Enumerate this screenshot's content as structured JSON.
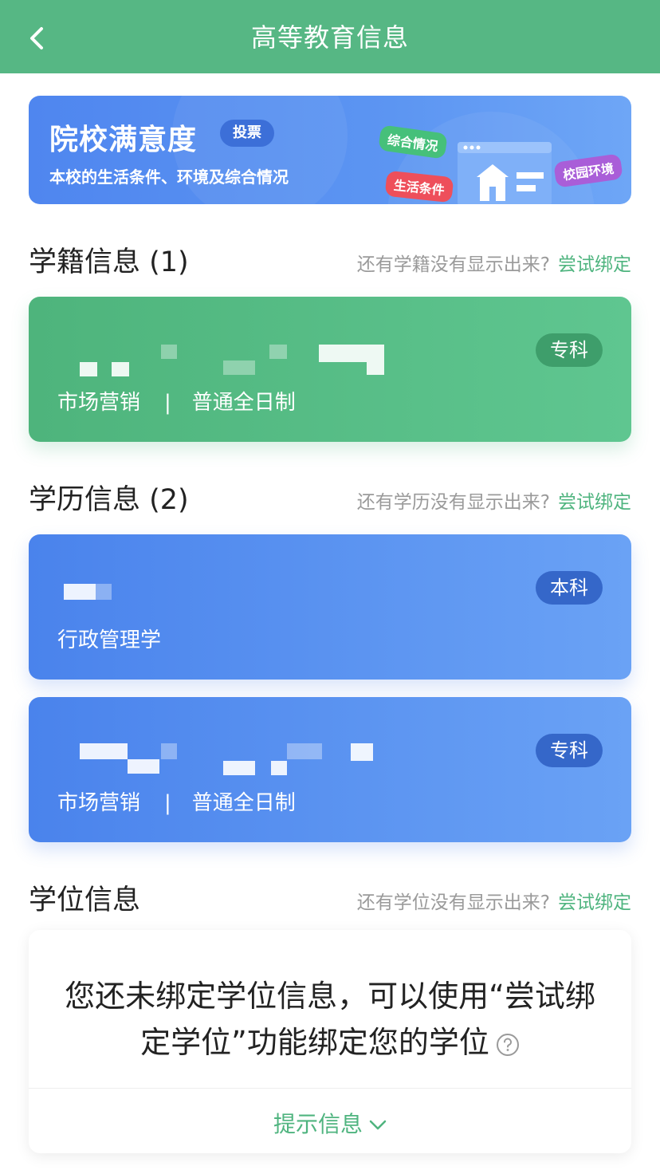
{
  "header": {
    "title": "高等教育信息",
    "back_icon": "chevron-left-icon"
  },
  "banner": {
    "title": "院校满意度",
    "vote_badge": "投票",
    "subtitle": "本校的生活条件、环境及综合情况",
    "tags": [
      "综合情况",
      "生活条件",
      "校园环境"
    ]
  },
  "sections": {
    "enrollment": {
      "title": "学籍信息 (1)",
      "hint": "还有学籍没有显示出来?",
      "link": "尝试绑定"
    },
    "education": {
      "title": "学历信息 (2)",
      "hint": "还有学历没有显示出来?",
      "link": "尝试绑定"
    },
    "degree": {
      "title": "学位信息",
      "hint": "还有学位没有显示出来?",
      "link": "尝试绑定"
    }
  },
  "cards": {
    "enrollment_1": {
      "level": "专科",
      "major": "市场营销",
      "separator": "|",
      "mode": "普通全日制"
    },
    "education_1": {
      "level": "本科",
      "major": "行政管理学"
    },
    "education_2": {
      "level": "专科",
      "major": "市场营销",
      "separator": "|",
      "mode": "普通全日制"
    }
  },
  "degree_card": {
    "message": "您还未绑定学位信息，可以使用“尝试绑定学位”功能绑定您的学位",
    "tip": "提示信息"
  },
  "colors": {
    "green": "#56b784",
    "blue": "#4f86ef",
    "link": "#4fb47f"
  }
}
